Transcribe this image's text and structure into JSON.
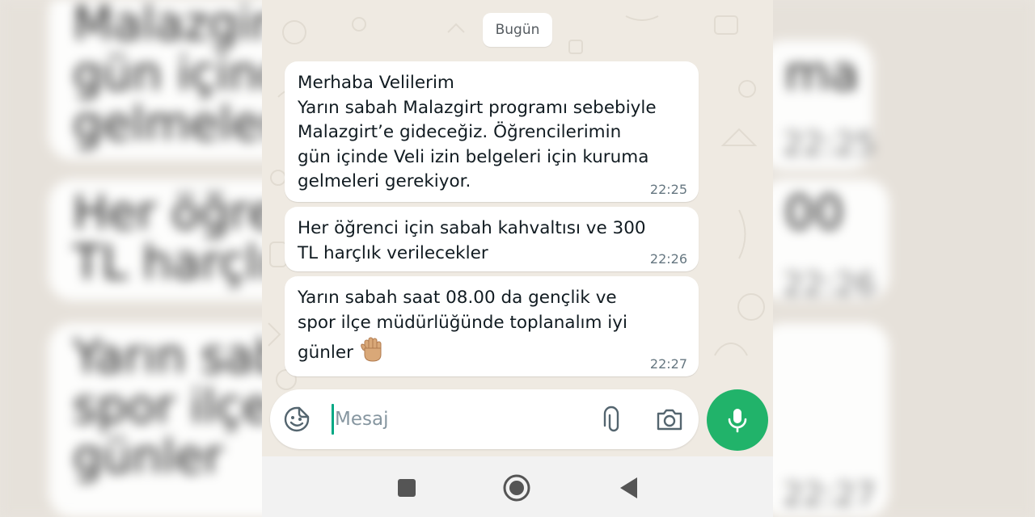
{
  "background": {
    "cards": [
      {
        "text": "Malazgirt'e\ngün içinde\ngelmeleri g"
      },
      {
        "text": "Her öğrenci\nTL harçlık"
      },
      {
        "text": "Yarın sabah\nspor ilçe m\ngünler"
      }
    ],
    "right_fragments": [
      "ma",
      "00"
    ],
    "right_times": [
      "22:25",
      "22:26",
      "22:27"
    ]
  },
  "chat": {
    "date_label": "Bugün",
    "messages": [
      {
        "text": "Merhaba Velilerim\nYarın sabah Malazgirt programı sebebiyle\nMalazgirt’e gideceğiz. Öğrencilerimin\ngün içinde Veli izin belgeleri için kuruma\ngelmeleri gerekiyor.",
        "time": "22:25"
      },
      {
        "text": "Her öğrenci için sabah kahvaltısı ve 300\nTL harçlık verilecekler",
        "time": "22:26"
      },
      {
        "text": "Yarın sabah saat  08.00 da gençlik ve\nspor ilçe müdürlüğünde toplanalım iyi\ngünler",
        "emoji": "raised-hand",
        "time": "22:27"
      }
    ]
  },
  "composer": {
    "placeholder": "Mesaj",
    "icons": {
      "emoji": "sticker-smiley-icon",
      "attach": "paperclip-icon",
      "camera": "camera-icon",
      "mic": "microphone-icon"
    }
  },
  "colors": {
    "accent": "#21b36a",
    "chat_bg": "#efeae2",
    "bubble": "#ffffff",
    "time": "#667781"
  },
  "navigation": {
    "icons": [
      "recents-square-icon",
      "home-circle-icon",
      "back-triangle-icon"
    ]
  }
}
